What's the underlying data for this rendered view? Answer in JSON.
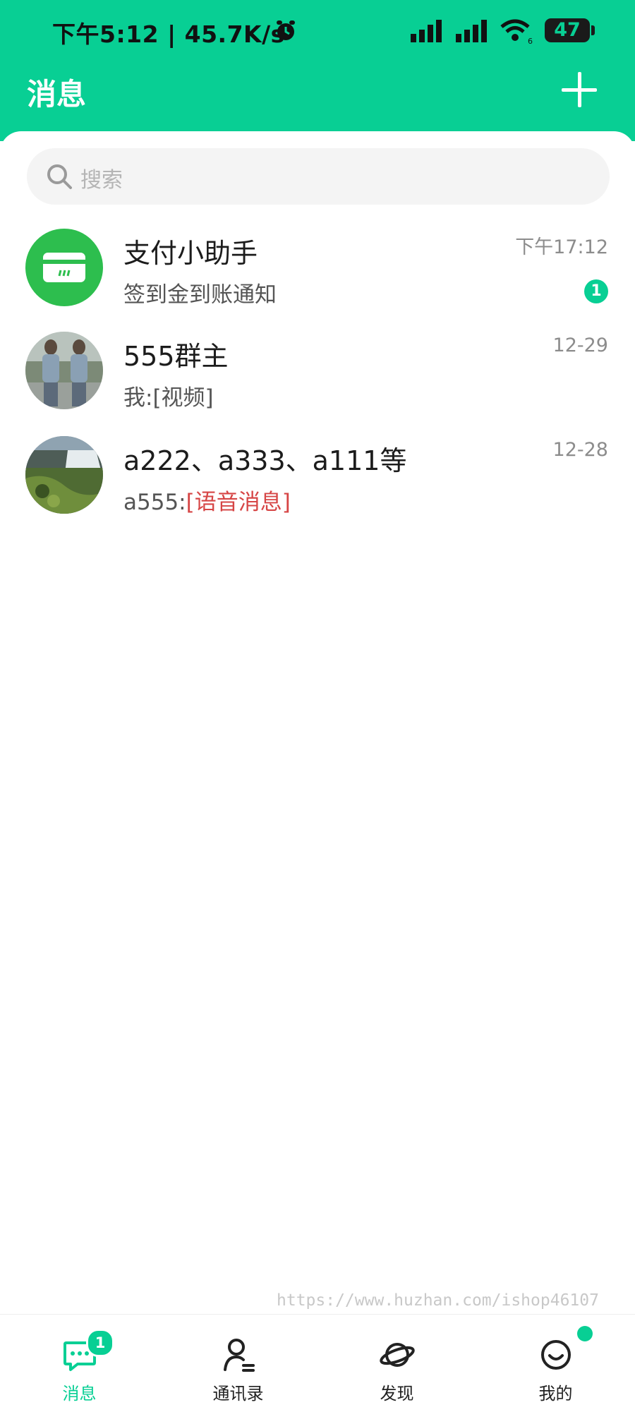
{
  "colors": {
    "accent": "#08CF94",
    "voice_red": "#D64545"
  },
  "status_bar": {
    "time_speed": "下午5:12 | 45.7K/s",
    "wifi_label": "6",
    "battery": "47"
  },
  "header": {
    "title": "消息",
    "add_icon": "plus-icon"
  },
  "search": {
    "placeholder": "搜索",
    "icon": "search-icon"
  },
  "chats": [
    {
      "name": "支付小助手",
      "preview": "签到金到账通知",
      "time": "下午17:12",
      "unread": "1",
      "avatar": "payment-card-icon"
    },
    {
      "name": "555群主",
      "preview": "我:[视频]",
      "time": "12-29",
      "avatar": "photo-avatar-people"
    },
    {
      "name": "a222、a333、a111等",
      "preview_sender": "a555:",
      "preview_tag": "[语音消息]",
      "time": "12-28",
      "avatar": "photo-avatar-waterfall"
    }
  ],
  "watermark": "https://www.huzhan.com/ishop46107",
  "tabs": [
    {
      "label": "消息",
      "icon": "chat-bubble-icon",
      "badge": "1",
      "active": true
    },
    {
      "label": "通讯录",
      "icon": "contacts-icon"
    },
    {
      "label": "发现",
      "icon": "planet-icon"
    },
    {
      "label": "我的",
      "icon": "smile-face-icon",
      "dot": true
    }
  ]
}
